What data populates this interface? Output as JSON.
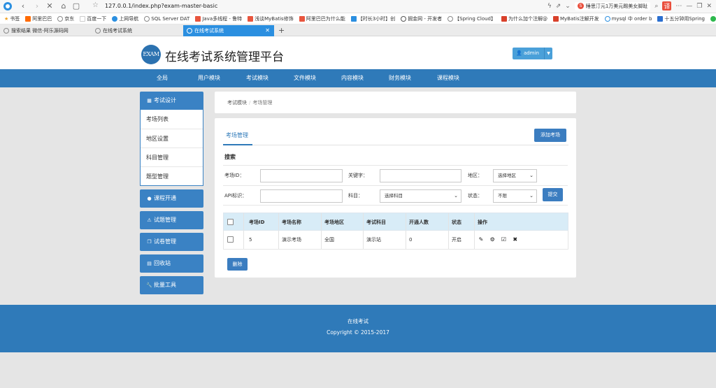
{
  "browser": {
    "url": "127.0.0.1/index.php?exam-master-basic",
    "search_suggest": "睡思汀元1万美元踢美女脚趾",
    "bookmarks": [
      "书签",
      "阿里巴巴",
      "京东",
      "百度一下",
      "上网导航",
      "SQL Server DAT",
      "Java多线程 - 鲁特",
      "浅谈MyBatis修饰",
      "阿里巴巴为什么能",
      "【时长3小时】创",
      "掘金网 - 开发者",
      "【Spring Cloud】",
      "为什么加个注解@",
      "MyBatis注解开发",
      "mysql 中 order b",
      "十五分钟用Spring",
      "spri"
    ],
    "tabs": [
      "搜索结果 微信-阿乐源码网",
      "在线考试系统",
      "在线考试系统"
    ],
    "new_tab": "+"
  },
  "header": {
    "logo": "EXAM",
    "title": "在线考试系统管理平台",
    "user": "admin"
  },
  "nav": [
    "全局",
    "用户模块",
    "考试模块",
    "文件模块",
    "内容模块",
    "财务模块",
    "课程模块"
  ],
  "sidebar": {
    "active_group": "考试设计",
    "sub_items": [
      "考场列表",
      "地区设置",
      "科目管理",
      "题型管理"
    ],
    "groups": [
      "课程开通",
      "试题管理",
      "试卷管理",
      "回收站",
      "批量工具"
    ]
  },
  "breadcrumb": {
    "root": "考试模块",
    "sep": "/",
    "current": "考场管理"
  },
  "panel": {
    "tab": "考场管理",
    "add_button": "添加考场",
    "search_title": "搜索",
    "fields": {
      "room_id": "考场ID：",
      "keyword": "关键字：",
      "region": "地区：",
      "region_value": "选择地区",
      "api": "API标识：",
      "subject": "科目：",
      "subject_value": "选择科目",
      "status": "状态：",
      "status_value": "不限"
    },
    "submit": "提交",
    "delete": "删除"
  },
  "table": {
    "headers": [
      "考场ID",
      "考场名称",
      "考场地区",
      "考试科目",
      "开通人数",
      "状态",
      "操作"
    ],
    "rows": [
      {
        "id": "5",
        "name": "演示考场",
        "region": "全国",
        "subject": "演示站",
        "count": "0",
        "status": "开启"
      }
    ]
  },
  "footer": {
    "line1": "在线考试",
    "line2": "Copyright © 2015-2017"
  }
}
